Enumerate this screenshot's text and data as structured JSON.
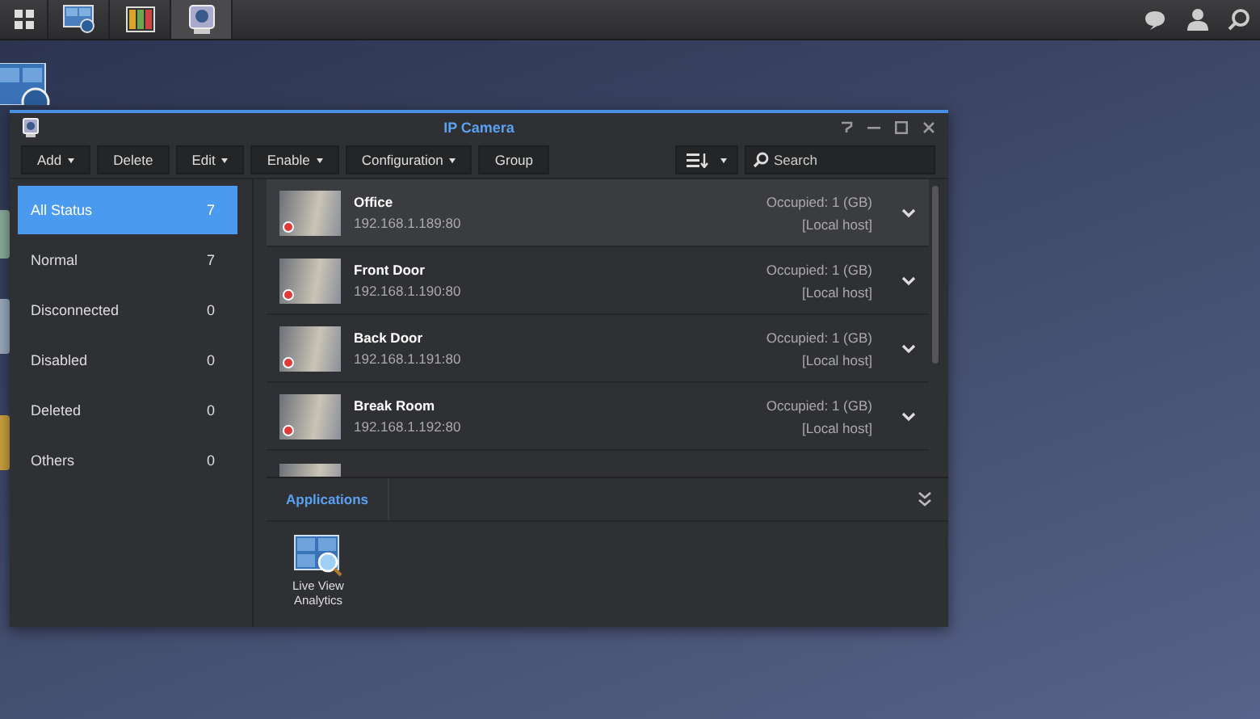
{
  "taskbar": {
    "apps": [
      {
        "kind": "monitor",
        "selected": false
      },
      {
        "kind": "board",
        "selected": false
      },
      {
        "kind": "camera",
        "selected": true
      }
    ]
  },
  "window": {
    "title": "IP Camera"
  },
  "toolbar": {
    "buttons": [
      {
        "label": "Add",
        "dropdown": true
      },
      {
        "label": "Delete",
        "dropdown": false
      },
      {
        "label": "Edit",
        "dropdown": true
      },
      {
        "label": "Enable",
        "dropdown": true
      },
      {
        "label": "Configuration",
        "dropdown": true
      },
      {
        "label": "Group",
        "dropdown": false
      }
    ]
  },
  "search": {
    "placeholder": "Search"
  },
  "sidebar": {
    "items": [
      {
        "label": "All Status",
        "count": "7",
        "selected": true
      },
      {
        "label": "Normal",
        "count": "7",
        "selected": false
      },
      {
        "label": "Disconnected",
        "count": "0",
        "selected": false
      },
      {
        "label": "Disabled",
        "count": "0",
        "selected": false
      },
      {
        "label": "Deleted",
        "count": "0",
        "selected": false
      },
      {
        "label": "Others",
        "count": "0",
        "selected": false
      }
    ]
  },
  "cameras": [
    {
      "name": "Office",
      "address": "192.168.1.189:80",
      "storage": "Occupied: 1 (GB)",
      "host": "[Local host]",
      "recording": true,
      "selected": true
    },
    {
      "name": "Front Door",
      "address": "192.168.1.190:80",
      "storage": "Occupied: 1 (GB)",
      "host": "[Local host]",
      "recording": true,
      "selected": false
    },
    {
      "name": "Back Door",
      "address": "192.168.1.191:80",
      "storage": "Occupied: 1 (GB)",
      "host": "[Local host]",
      "recording": true,
      "selected": false
    },
    {
      "name": "Break Room",
      "address": "192.168.1.192:80",
      "storage": "Occupied: 1 (GB)",
      "host": "[Local host]",
      "recording": true,
      "selected": false
    }
  ],
  "applications": {
    "tab": "Applications",
    "items": [
      {
        "label": "Live View Analytics"
      }
    ]
  }
}
